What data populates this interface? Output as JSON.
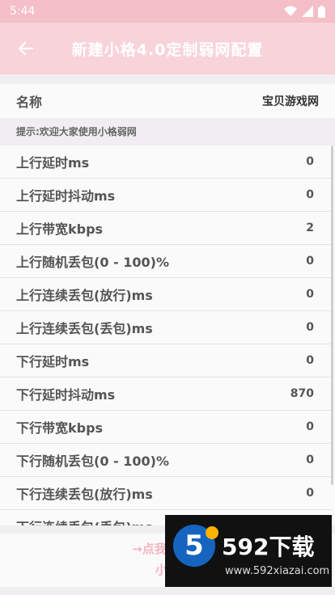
{
  "status_bar": {
    "time": "5:44"
  },
  "app_bar": {
    "title": "新建小格4.0定制弱网配置"
  },
  "name_row": {
    "label": "名称",
    "value": "宝贝游戏网"
  },
  "hint": "提示:欢迎大家使用小格弱网",
  "rows": [
    {
      "label": "上行延时ms",
      "value": "0"
    },
    {
      "label": "上行延时抖动ms",
      "value": "0"
    },
    {
      "label": "上行带宽kbps",
      "value": "2"
    },
    {
      "label": "上行随机丢包(0 - 100)%",
      "value": "0"
    },
    {
      "label": "上行连续丢包(放行)ms",
      "value": "0"
    },
    {
      "label": "上行连续丢包(丢包)ms",
      "value": "0"
    },
    {
      "label": "下行延时ms",
      "value": "0"
    },
    {
      "label": "下行延时抖动ms",
      "value": "870"
    },
    {
      "label": "下行带宽kbps",
      "value": "0"
    },
    {
      "label": "下行随机丢包(0 - 100)%",
      "value": "0"
    },
    {
      "label": "下行连续丢包(放行)ms",
      "value": "0"
    },
    {
      "label": "下行连续丢包(丢包)ms",
      "value": ""
    }
  ],
  "save": {
    "line1": "→点我保存当",
    "line2": "小格"
  },
  "watermark": {
    "logo_char": "5",
    "brand": "592下载",
    "url": "www.592xiazai.com"
  },
  "colors": {
    "app_bar": "#f9d3da",
    "status_bar": "#f4bfc6",
    "accent": "#f5b3bf"
  }
}
